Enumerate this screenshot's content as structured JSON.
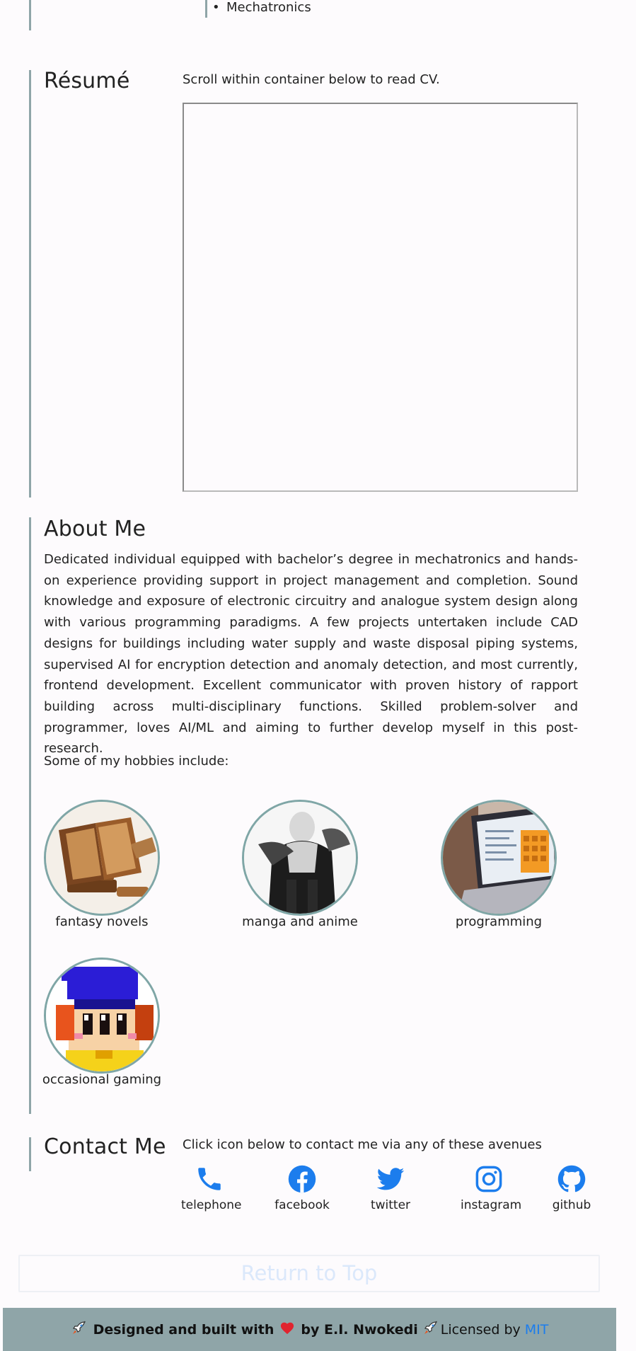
{
  "top_list": {
    "item": "Mechatronics"
  },
  "resume": {
    "heading": "Résumé",
    "instruction": "Scroll within container below to read CV."
  },
  "about": {
    "heading": "About Me",
    "paragraph": "Dedicated individual equipped with bachelor’s degree in mechatronics and hands-on experience providing support in project management and completion. Sound knowledge and exposure of electronic circuitry and analogue system design along with various programming paradigms. A few projects untertaken include CAD designs for buildings including water supply and waste disposal piping systems, supervised AI for encryption detection and anomaly detection, and most currently, frontend development. Excellent communicator with proven history of rapport building across multi-disciplinary functions. Skilled problem-solver and programmer, loves AI/ML and aiming to further develop myself in this post-research.",
    "hobbies_intro": "Some of my hobbies include:",
    "hobbies": [
      {
        "label": "fantasy novels"
      },
      {
        "label": "manga and anime"
      },
      {
        "label": "programming"
      },
      {
        "label": "occasional gaming"
      }
    ]
  },
  "contact": {
    "heading": "Contact Me",
    "instruction": "Click icon below to contact me via any of these avenues",
    "items": [
      {
        "label": "telephone",
        "icon": "phone-icon"
      },
      {
        "label": "facebook",
        "icon": "facebook-icon"
      },
      {
        "label": "twitter",
        "icon": "twitter-icon"
      },
      {
        "label": "instagram",
        "icon": "instagram-icon"
      },
      {
        "label": "github",
        "icon": "github-icon"
      }
    ],
    "icon_color": "#1c7ded"
  },
  "return_top": {
    "label": "Return to Top"
  },
  "footer": {
    "designed_text": "Designed and built with",
    "by_text": "by E.I. Nwokedi",
    "license_text": "Licensed by",
    "license_link": "MIT",
    "bar_color": "#8fa5a8"
  }
}
